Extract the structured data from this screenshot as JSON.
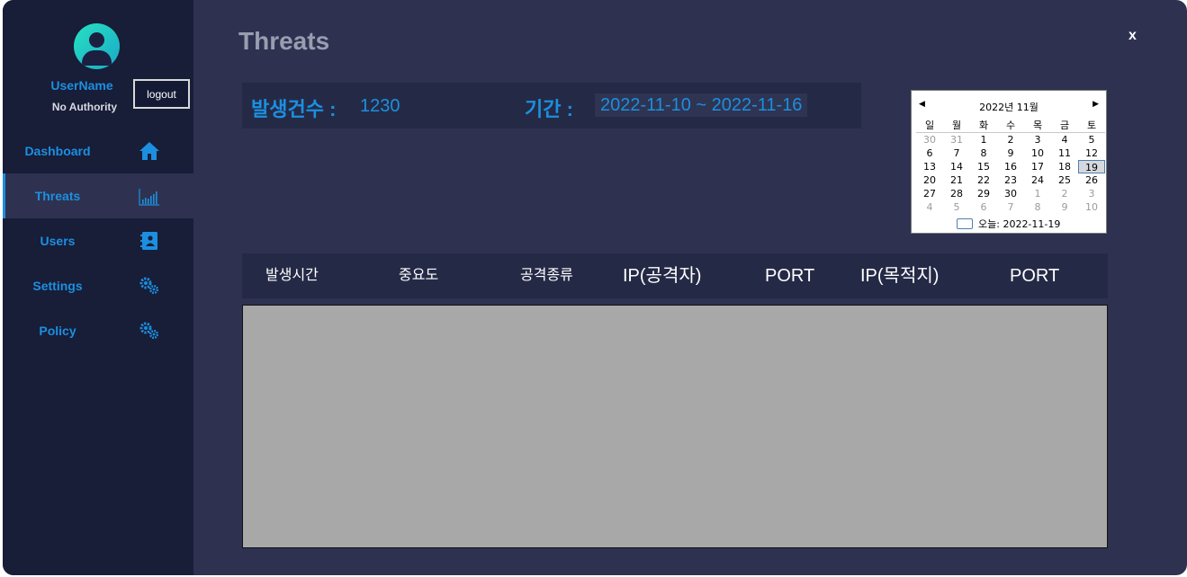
{
  "window": {
    "title": "Threats",
    "close_label": "x"
  },
  "sidebar": {
    "username": "UserName",
    "authority": "No Authority",
    "logout_label": "logout",
    "items": [
      {
        "label": "Dashboard",
        "icon": "home-icon"
      },
      {
        "label": "Threats",
        "icon": "chart-icon",
        "active": true
      },
      {
        "label": "Users",
        "icon": "contact-book-icon"
      },
      {
        "label": "Settings",
        "icon": "gears-icon"
      },
      {
        "label": "Policy",
        "icon": "gears-icon"
      }
    ]
  },
  "summary": {
    "count_label": "발생건수 :",
    "count_value": "1230",
    "period_label": "기간 :",
    "period_value": "2022-11-10 ~ 2022-11-16"
  },
  "calendar": {
    "header": "2022년 11월",
    "weekdays": [
      "일",
      "월",
      "화",
      "수",
      "목",
      "금",
      "토"
    ],
    "weeks": [
      [
        "30",
        "31",
        "1",
        "2",
        "3",
        "4",
        "5"
      ],
      [
        "6",
        "7",
        "8",
        "9",
        "10",
        "11",
        "12"
      ],
      [
        "13",
        "14",
        "15",
        "16",
        "17",
        "18",
        "19"
      ],
      [
        "20",
        "21",
        "22",
        "23",
        "24",
        "25",
        "26"
      ],
      [
        "27",
        "28",
        "29",
        "30",
        "1",
        "2",
        "3"
      ],
      [
        "4",
        "5",
        "6",
        "7",
        "8",
        "9",
        "10"
      ]
    ],
    "today_label": "오늘: 2022-11-19"
  },
  "table": {
    "columns": [
      "발생시간",
      "중요도",
      "공격종류",
      "IP(공격자)",
      "PORT",
      "IP(목적지)",
      "PORT"
    ]
  },
  "colors": {
    "accent": "#1c8fe0",
    "sidebar_bg": "#181d38",
    "main_bg": "#2e3250",
    "panel_bg": "#242a46",
    "grid_bg": "#a8a8a8"
  }
}
